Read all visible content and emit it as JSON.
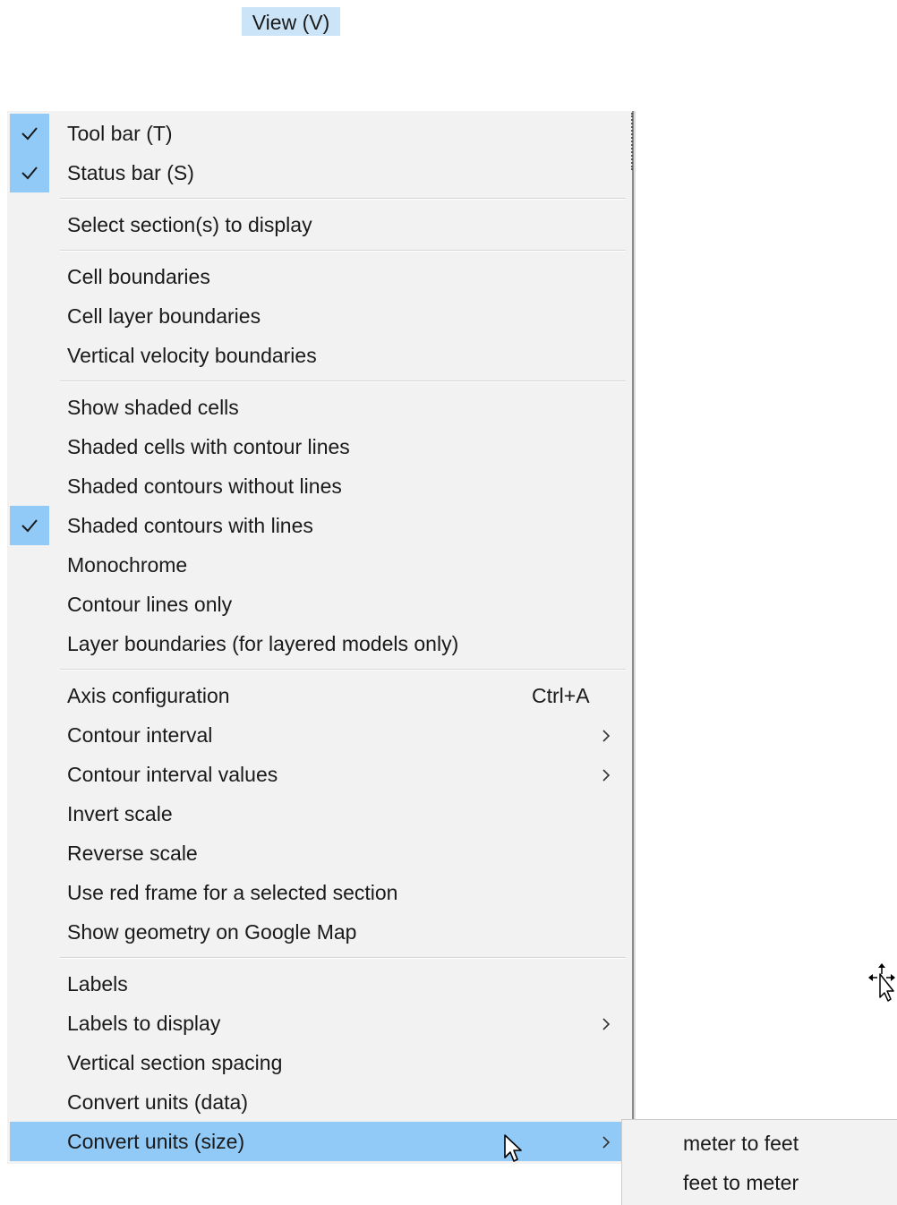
{
  "menubar": {
    "view_label": "View (V)"
  },
  "menu": {
    "items": [
      {
        "label": "Tool bar (T)",
        "checked": true
      },
      {
        "label": "Status bar (S)",
        "checked": true
      },
      {
        "label": "Select section(s) to display"
      },
      {
        "label": "Cell boundaries"
      },
      {
        "label": "Cell layer boundaries"
      },
      {
        "label": "Vertical velocity boundaries"
      },
      {
        "label": "Show shaded cells"
      },
      {
        "label": "Shaded cells with contour lines"
      },
      {
        "label": "Shaded contours without lines"
      },
      {
        "label": "Shaded contours with lines",
        "checked": true
      },
      {
        "label": "Monochrome"
      },
      {
        "label": "Contour lines only"
      },
      {
        "label": "Layer boundaries (for layered models only)"
      },
      {
        "label": "Axis configuration",
        "shortcut": "Ctrl+A"
      },
      {
        "label": "Contour interval",
        "submenu": true
      },
      {
        "label": "Contour interval values",
        "submenu": true
      },
      {
        "label": "Invert scale"
      },
      {
        "label": "Reverse scale"
      },
      {
        "label": "Use red frame for a selected section"
      },
      {
        "label": "Show geometry on Google Map"
      },
      {
        "label": "Labels"
      },
      {
        "label": "Labels to display",
        "submenu": true
      },
      {
        "label": "Vertical section spacing"
      },
      {
        "label": "Convert units (data)"
      },
      {
        "label": "Convert units (size)",
        "submenu": true,
        "selected": true
      }
    ]
  },
  "submenu": {
    "items": [
      {
        "label": "meter to feet"
      },
      {
        "label": "feet to meter"
      }
    ]
  },
  "colors": {
    "highlight": "#91c9f7",
    "menubar_highlight": "#cce4f7",
    "menu_background": "#f2f2f2"
  },
  "icons": {
    "check": "checkmark-icon",
    "submenu": "chevron-right-icon",
    "pointer": "mouse-pointer-icon",
    "move": "move-cursor-icon"
  }
}
